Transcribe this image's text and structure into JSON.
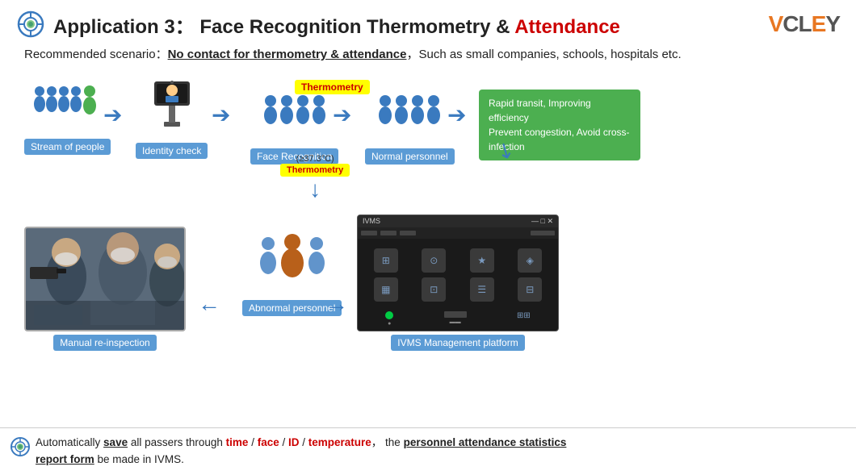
{
  "header": {
    "app_number": "Application 3",
    "colon": "：",
    "title_normal": "Face Recognition Thermometry & ",
    "title_highlight": "Attendance",
    "logo": "VCLEY"
  },
  "scenario": {
    "prefix": "Recommended scenario：",
    "underline_text": "No contact for thermometry & attendance",
    "suffix": "，Such as small companies, schools, hospitals etc."
  },
  "flow": {
    "items": [
      {
        "id": "stream",
        "label": "Stream of people"
      },
      {
        "id": "identity",
        "label": "Identity check"
      },
      {
        "id": "face",
        "label": "Face Recognition"
      },
      {
        "id": "normal",
        "label": "Normal personnel"
      },
      {
        "id": "abnormal",
        "label": "Abnormal personnel"
      },
      {
        "id": "manual",
        "label": "Manual re-inspection"
      },
      {
        "id": "ivms",
        "label": "IVMS Management platform"
      }
    ],
    "thermometry_tag": "Thermometry",
    "thermometry_tag2": "Thermometry",
    "temp_threshold": "(≥37.3°C)",
    "green_box_line1": "Rapid transit, Improving efficiency",
    "green_box_line2": "Prevent congestion, Avoid cross-infection",
    "ivms_title": "IVMS"
  },
  "bottom": {
    "text_before": "Automatically ",
    "save_bold": "save",
    "text_after_save": " all passers through ",
    "time": "time",
    "slash1": " / ",
    "face": "face",
    "slash2": " / ",
    "id": "ID",
    "slash3": " / ",
    "temperature": "temperature",
    "comma": "，",
    "text_middle": " the ",
    "stats_bold": "personnel attendance statistics",
    "report_bold": "report form",
    "text_end": " be made in IVMS."
  },
  "colors": {
    "blue": "#3a7abf",
    "green": "#4caf50",
    "red": "#cc0000",
    "orange": "#e87722",
    "yellow": "#ffff00",
    "dark": "#1a1a1a"
  }
}
